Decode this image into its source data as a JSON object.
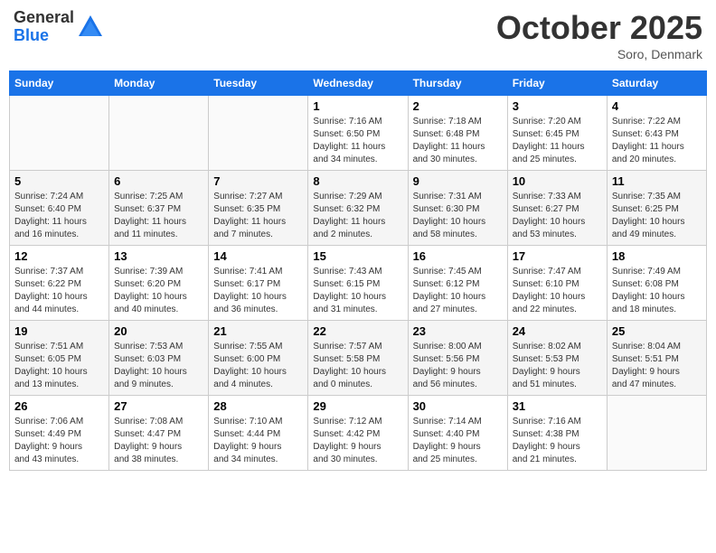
{
  "header": {
    "logo_general": "General",
    "logo_blue": "Blue",
    "title": "October 2025",
    "location": "Soro, Denmark"
  },
  "weekdays": [
    "Sunday",
    "Monday",
    "Tuesday",
    "Wednesday",
    "Thursday",
    "Friday",
    "Saturday"
  ],
  "weeks": [
    [
      {
        "day": "",
        "info": ""
      },
      {
        "day": "",
        "info": ""
      },
      {
        "day": "",
        "info": ""
      },
      {
        "day": "1",
        "info": "Sunrise: 7:16 AM\nSunset: 6:50 PM\nDaylight: 11 hours\nand 34 minutes."
      },
      {
        "day": "2",
        "info": "Sunrise: 7:18 AM\nSunset: 6:48 PM\nDaylight: 11 hours\nand 30 minutes."
      },
      {
        "day": "3",
        "info": "Sunrise: 7:20 AM\nSunset: 6:45 PM\nDaylight: 11 hours\nand 25 minutes."
      },
      {
        "day": "4",
        "info": "Sunrise: 7:22 AM\nSunset: 6:43 PM\nDaylight: 11 hours\nand 20 minutes."
      }
    ],
    [
      {
        "day": "5",
        "info": "Sunrise: 7:24 AM\nSunset: 6:40 PM\nDaylight: 11 hours\nand 16 minutes."
      },
      {
        "day": "6",
        "info": "Sunrise: 7:25 AM\nSunset: 6:37 PM\nDaylight: 11 hours\nand 11 minutes."
      },
      {
        "day": "7",
        "info": "Sunrise: 7:27 AM\nSunset: 6:35 PM\nDaylight: 11 hours\nand 7 minutes."
      },
      {
        "day": "8",
        "info": "Sunrise: 7:29 AM\nSunset: 6:32 PM\nDaylight: 11 hours\nand 2 minutes."
      },
      {
        "day": "9",
        "info": "Sunrise: 7:31 AM\nSunset: 6:30 PM\nDaylight: 10 hours\nand 58 minutes."
      },
      {
        "day": "10",
        "info": "Sunrise: 7:33 AM\nSunset: 6:27 PM\nDaylight: 10 hours\nand 53 minutes."
      },
      {
        "day": "11",
        "info": "Sunrise: 7:35 AM\nSunset: 6:25 PM\nDaylight: 10 hours\nand 49 minutes."
      }
    ],
    [
      {
        "day": "12",
        "info": "Sunrise: 7:37 AM\nSunset: 6:22 PM\nDaylight: 10 hours\nand 44 minutes."
      },
      {
        "day": "13",
        "info": "Sunrise: 7:39 AM\nSunset: 6:20 PM\nDaylight: 10 hours\nand 40 minutes."
      },
      {
        "day": "14",
        "info": "Sunrise: 7:41 AM\nSunset: 6:17 PM\nDaylight: 10 hours\nand 36 minutes."
      },
      {
        "day": "15",
        "info": "Sunrise: 7:43 AM\nSunset: 6:15 PM\nDaylight: 10 hours\nand 31 minutes."
      },
      {
        "day": "16",
        "info": "Sunrise: 7:45 AM\nSunset: 6:12 PM\nDaylight: 10 hours\nand 27 minutes."
      },
      {
        "day": "17",
        "info": "Sunrise: 7:47 AM\nSunset: 6:10 PM\nDaylight: 10 hours\nand 22 minutes."
      },
      {
        "day": "18",
        "info": "Sunrise: 7:49 AM\nSunset: 6:08 PM\nDaylight: 10 hours\nand 18 minutes."
      }
    ],
    [
      {
        "day": "19",
        "info": "Sunrise: 7:51 AM\nSunset: 6:05 PM\nDaylight: 10 hours\nand 13 minutes."
      },
      {
        "day": "20",
        "info": "Sunrise: 7:53 AM\nSunset: 6:03 PM\nDaylight: 10 hours\nand 9 minutes."
      },
      {
        "day": "21",
        "info": "Sunrise: 7:55 AM\nSunset: 6:00 PM\nDaylight: 10 hours\nand 4 minutes."
      },
      {
        "day": "22",
        "info": "Sunrise: 7:57 AM\nSunset: 5:58 PM\nDaylight: 10 hours\nand 0 minutes."
      },
      {
        "day": "23",
        "info": "Sunrise: 8:00 AM\nSunset: 5:56 PM\nDaylight: 9 hours\nand 56 minutes."
      },
      {
        "day": "24",
        "info": "Sunrise: 8:02 AM\nSunset: 5:53 PM\nDaylight: 9 hours\nand 51 minutes."
      },
      {
        "day": "25",
        "info": "Sunrise: 8:04 AM\nSunset: 5:51 PM\nDaylight: 9 hours\nand 47 minutes."
      }
    ],
    [
      {
        "day": "26",
        "info": "Sunrise: 7:06 AM\nSunset: 4:49 PM\nDaylight: 9 hours\nand 43 minutes."
      },
      {
        "day": "27",
        "info": "Sunrise: 7:08 AM\nSunset: 4:47 PM\nDaylight: 9 hours\nand 38 minutes."
      },
      {
        "day": "28",
        "info": "Sunrise: 7:10 AM\nSunset: 4:44 PM\nDaylight: 9 hours\nand 34 minutes."
      },
      {
        "day": "29",
        "info": "Sunrise: 7:12 AM\nSunset: 4:42 PM\nDaylight: 9 hours\nand 30 minutes."
      },
      {
        "day": "30",
        "info": "Sunrise: 7:14 AM\nSunset: 4:40 PM\nDaylight: 9 hours\nand 25 minutes."
      },
      {
        "day": "31",
        "info": "Sunrise: 7:16 AM\nSunset: 4:38 PM\nDaylight: 9 hours\nand 21 minutes."
      },
      {
        "day": "",
        "info": ""
      }
    ]
  ]
}
